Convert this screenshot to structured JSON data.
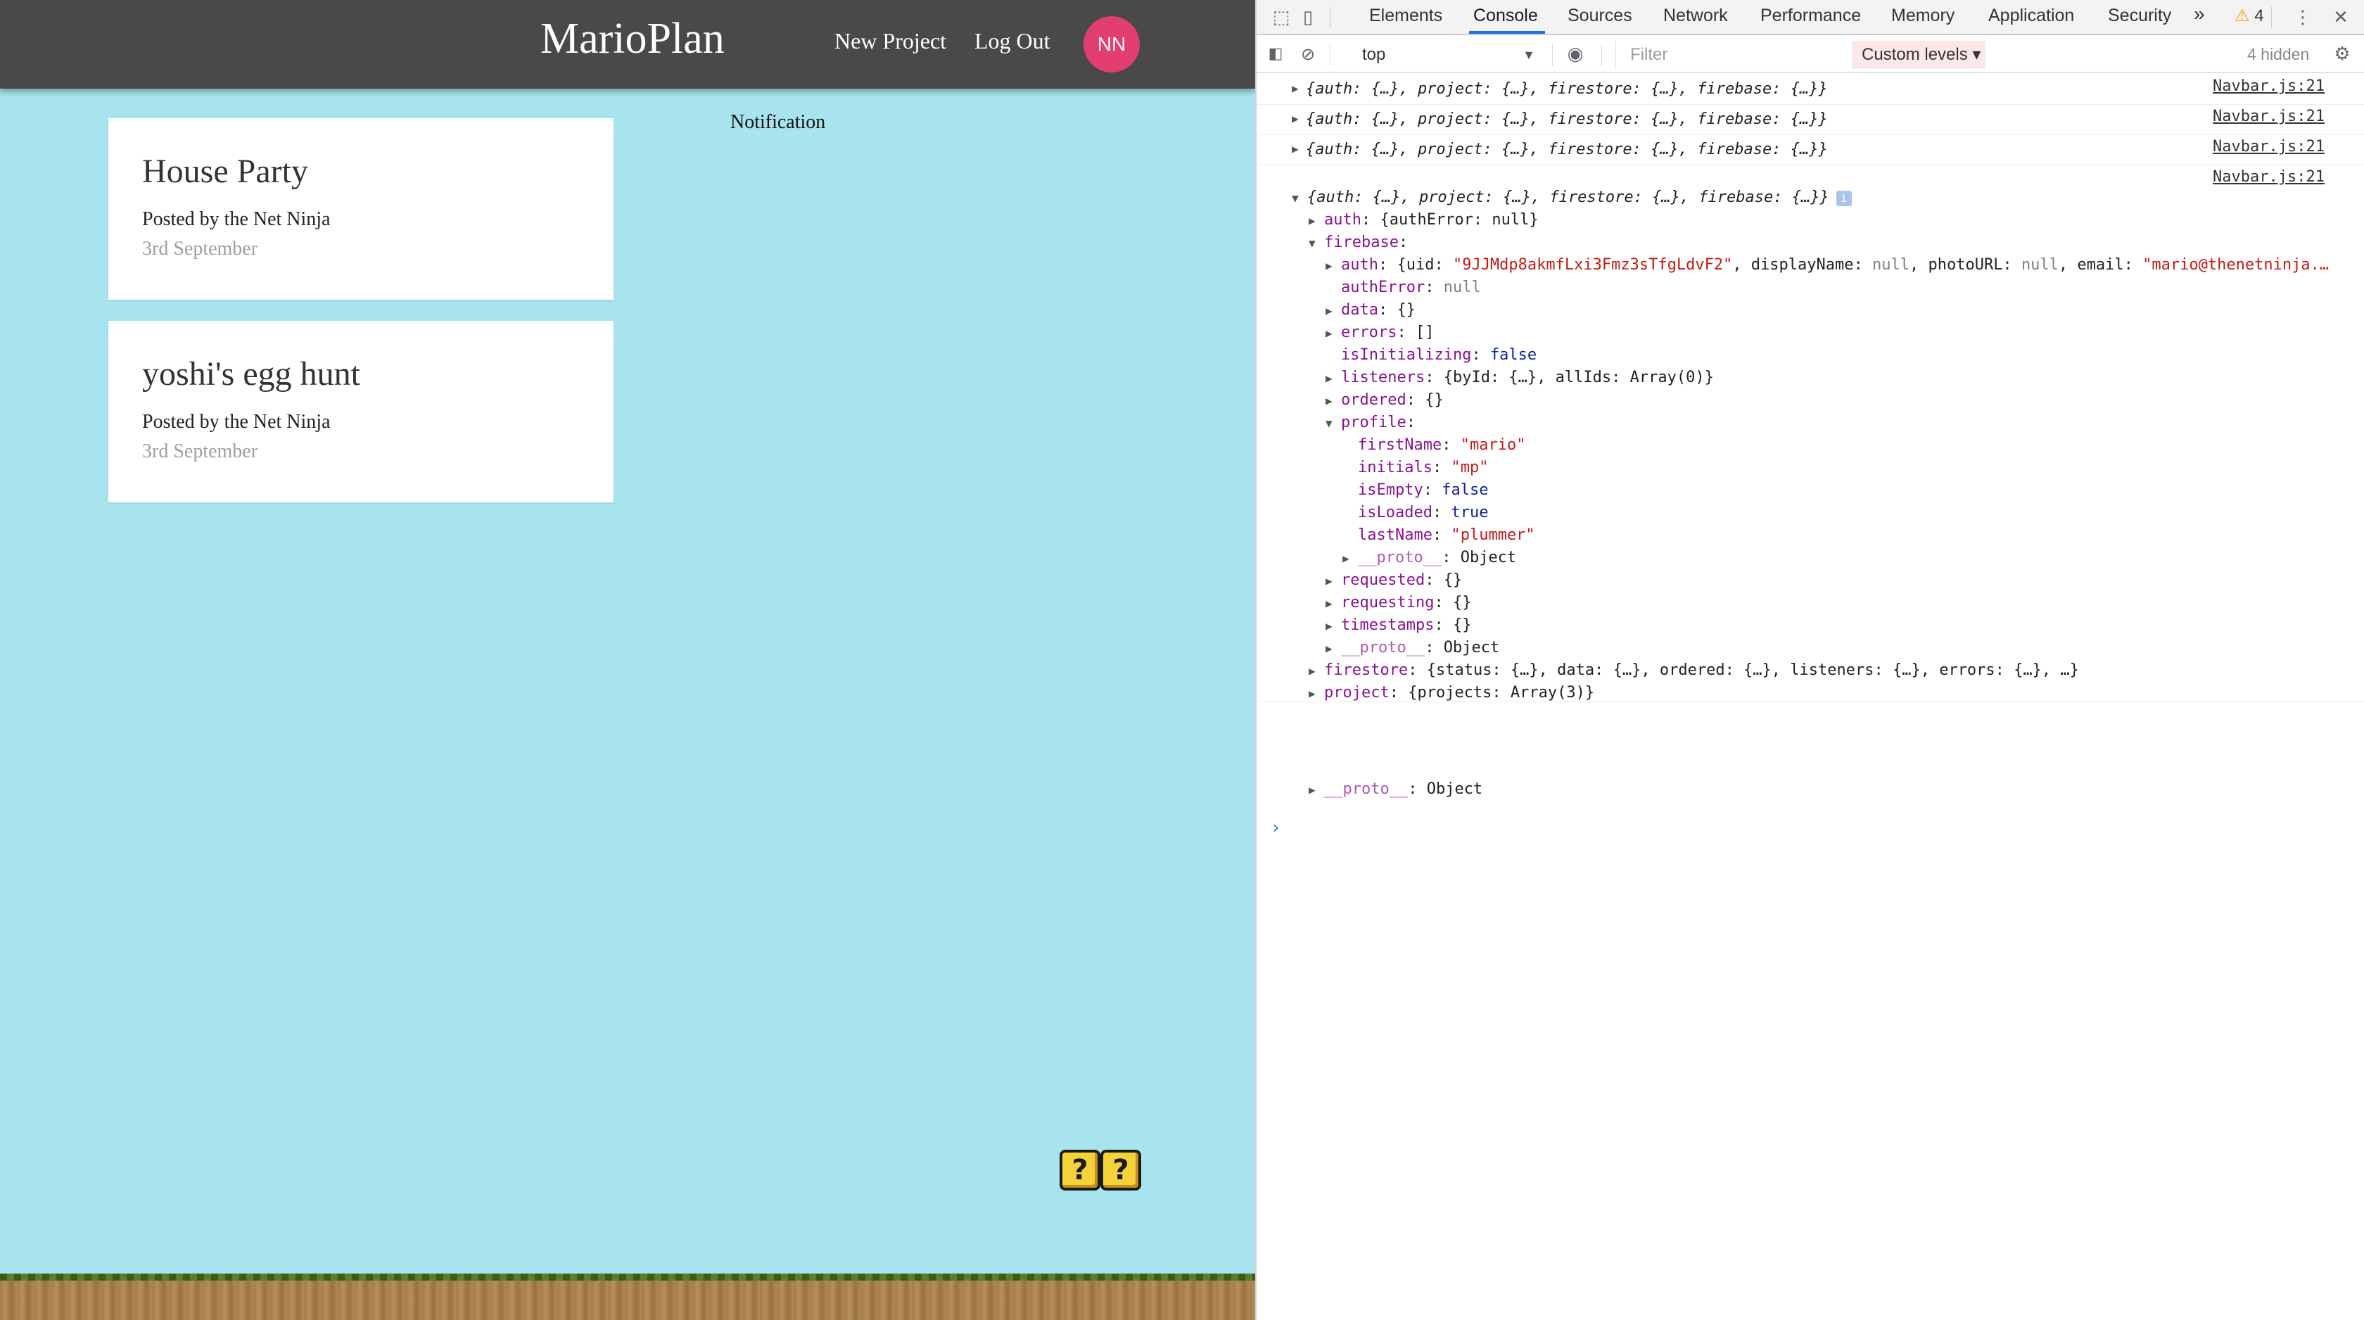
{
  "app": {
    "brand": "MarioPlan",
    "nav": {
      "new_project": "New Project",
      "log_out": "Log Out",
      "avatar_initials": "NN"
    },
    "projects": [
      {
        "title": "House Party",
        "author": "Posted by the Net Ninja",
        "date": "3rd September"
      },
      {
        "title": "yoshi's egg hunt",
        "author": "Posted by the Net Ninja",
        "date": "3rd September"
      }
    ],
    "notification_label": "Notification",
    "question_blocks": [
      "?",
      "?"
    ],
    "colors": {
      "sky": "#a8e4ee",
      "navbar": "#494949",
      "avatar": "#e23e6f"
    }
  },
  "devtools": {
    "tabs": [
      "Elements",
      "Console",
      "Sources",
      "Network",
      "Performance",
      "Memory",
      "Application",
      "Security"
    ],
    "active_tab": "Console",
    "more_tabs": "»",
    "warnings": "4",
    "toolbar": {
      "context": "top",
      "filter_placeholder": "Filter",
      "levels": "Custom levels ▾",
      "hidden": "4 hidden"
    },
    "messages": [
      {
        "text": "{auth: {…}, project: {…}, firestore: {…}, firebase: {…}}",
        "source": "Navbar.js:21"
      },
      {
        "text": "{auth: {…}, project: {…}, firestore: {…}, firebase: {…}}",
        "source": "Navbar.js:21"
      },
      {
        "text": "{auth: {…}, project: {…}, firestore: {…}, firebase: {…}}",
        "source": "Navbar.js:21"
      }
    ],
    "expanded": {
      "source": "Navbar.js:21",
      "summary": "{auth: {…}, project: {…}, firestore: {…}, firebase: {…}}",
      "auth": "{authError: null}",
      "firebase_auth_uid": "\"9JJMdp8akmfLxi3Fmz3sTfgLdvF2\"",
      "firebase_auth_email": "\"mario@thenetninja.…",
      "profile_first": "\"mario\"",
      "profile_initials": "\"mp\"",
      "profile_last": "\"plummer\"",
      "firestore": "{status: {…}, data: {…}, ordered: {…}, listeners: {…}, errors: {…}, …}",
      "project": "{projects: Array(3)}"
    },
    "prompt": "›"
  }
}
